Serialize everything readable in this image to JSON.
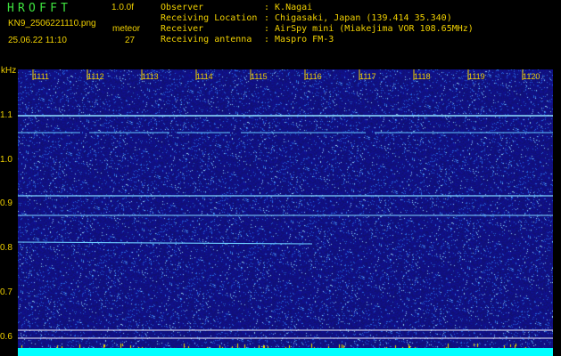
{
  "header": {
    "app_title": "HROFFT",
    "version": "1.0.0f",
    "filename": "KN9_2506221110.png",
    "format": "meteor",
    "timestamp": "25.06.22 11:10",
    "count": "27"
  },
  "info": {
    "rows": [
      {
        "label": "Observer",
        "value": ": K.Nagai"
      },
      {
        "label": "Receiving Location",
        "value": ": Chigasaki, Japan (139.414 35.340)"
      },
      {
        "label": "Receiver",
        "value": ": AirSpy mini (Miakejima VOR 108.65MHz)"
      },
      {
        "label": "Receiving antenna",
        "value": ": Maspro FM-3"
      }
    ]
  },
  "axis": {
    "y_unit": "kHz",
    "y_ticks": [
      "1.1",
      "1.0",
      "0.9",
      "0.8",
      "0.7",
      "0.6"
    ],
    "x_ticks": [
      "1111",
      "1112",
      "1113",
      "1114",
      "1115",
      "1116",
      "1117",
      "1118",
      "1119",
      "1120"
    ]
  },
  "colors": {
    "background": "#000000",
    "text": "#f0d000",
    "title": "#3ee23e",
    "waterfall": "#101088",
    "signal": "#7fd6ff",
    "bottom_band": "#00ffff"
  }
}
